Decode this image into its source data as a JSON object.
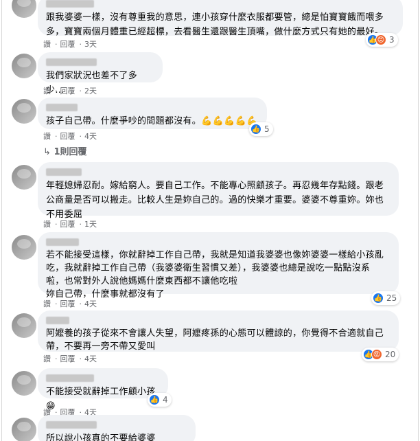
{
  "comments": [
    {
      "text": "跟我婆婆一樣，沒有尊重我的意思，連小孩穿什麼衣服都要管，總是怕寶寶餓而喂多\n多，寶寶兩個月體重已經超標，去看醫生還跟醫生頂嘴，做什麼方式只有她的最好。",
      "actions": {
        "like": "讚",
        "reply": "回覆",
        "time": "3天"
      },
      "reaction_count": "3"
    },
    {
      "text": "我們家狀況也差不了多少…",
      "actions": {
        "like": "讚",
        "reply": "回覆",
        "time": "2天"
      }
    },
    {
      "text": "孩子自己帶。什麼爭吵的問題都沒有。",
      "emoji": "💪💪💪💪💪",
      "actions": {
        "like": "讚",
        "reply": "回覆",
        "time": "4天"
      },
      "reaction_count": "5",
      "replies_link": "1則回覆"
    },
    {
      "text": "年輕媳婦忍耐。嫁給窮人。要自己工作。不能專心照顧孩子。再忍幾年存點錢。跟老\n公商量是否可以搬走。比較人生是妳自己的。過的快樂才重要。婆婆不尊重妳。妳也\n不用委屈",
      "actions": {
        "like": "讚",
        "reply": "回覆",
        "time": "1天"
      }
    },
    {
      "text": "若不能接受這樣，你就辭掉工作自己帶，我就是知道我婆婆也像妳婆婆一樣給小孩亂\n吃，我就辭掉工作自己帶（我婆婆衛生習慣又差），我婆婆也總是說吃一點點沒系\n啦，也常對外人說他媽媽什麼東西都不讓他吃啦\n妳自己帶，什麼事就都沒有了",
      "actions": {
        "like": "讚",
        "reply": "回覆",
        "time": "4天"
      },
      "reaction_count": "25"
    },
    {
      "text": "阿嬤養的孩子從來不會讓人失望，阿嬤疼孫的心態可以體諒的，你覺得不合適就自己\n帶，不要再一旁不帶又愛叫",
      "actions": {
        "like": "讚",
        "reply": "回覆",
        "time": "4天"
      },
      "reaction_count": "20"
    },
    {
      "text": "不能接受就辭掉工作顧小孩",
      "emoji": "😁",
      "actions": {
        "like": "讚",
        "reply": "回覆",
        "time": "4天"
      },
      "reaction_count": "4"
    },
    {
      "text": "所以說小孩真的不要給婆婆帶！！！"
    }
  ],
  "icons": {
    "like": "like-icon",
    "angry": "angry-icon"
  },
  "colors": {
    "bubble": "#f0f2f5",
    "like": "#1877f2",
    "angry": "#f0662e",
    "meta": "#65676b"
  }
}
